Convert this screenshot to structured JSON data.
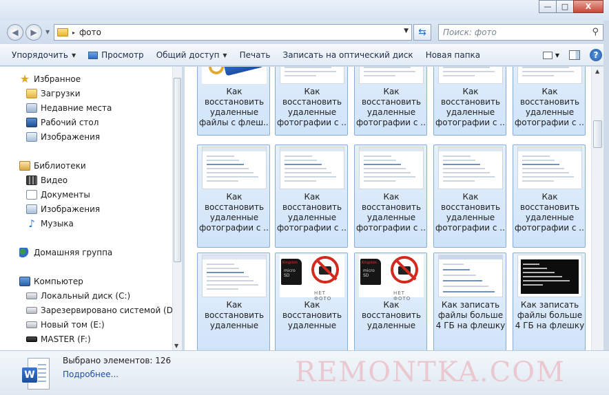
{
  "window": {
    "controls": {
      "minimize": "—",
      "maximize": "□",
      "close": "X"
    }
  },
  "address_bar": {
    "crumb_separator": "▸",
    "folder": "фото",
    "search_placeholder": "Поиск: фото"
  },
  "toolbar": {
    "items": [
      {
        "label": "Упорядочить",
        "has_arrow": true
      },
      {
        "label": "Просмотр",
        "has_arrow": false
      },
      {
        "label": "Общий доступ",
        "has_arrow": true
      },
      {
        "label": "Печать",
        "has_arrow": false
      },
      {
        "label": "Записать на оптический диск",
        "has_arrow": false
      },
      {
        "label": "Новая папка",
        "has_arrow": false
      }
    ],
    "help": "?"
  },
  "nav_pane": {
    "favorites": {
      "label": "Избранное",
      "icon": "star-icon"
    },
    "favorite_items": [
      {
        "label": "Загрузки",
        "icon": "downloads-folder-icon"
      },
      {
        "label": "Недавние места",
        "icon": "recent-places-icon"
      },
      {
        "label": "Рабочий стол",
        "icon": "desktop-icon"
      },
      {
        "label": "Изображения",
        "icon": "pictures-icon"
      }
    ],
    "libraries": {
      "label": "Библиотеки",
      "icon": "library-icon"
    },
    "library_items": [
      {
        "label": "Видео",
        "icon": "video-icon"
      },
      {
        "label": "Документы",
        "icon": "documents-icon"
      },
      {
        "label": "Изображения",
        "icon": "pictures-icon"
      },
      {
        "label": "Музыка",
        "icon": "music-icon"
      }
    ],
    "homegroup": {
      "label": "Домашняя группа",
      "icon": "homegroup-icon"
    },
    "computer": {
      "label": "Компьютер",
      "icon": "computer-icon"
    },
    "drives": [
      {
        "label": "Локальный диск (C:)",
        "icon": "system-drive-icon"
      },
      {
        "label": "Зарезервировано системой (D:)",
        "icon": "drive-icon"
      },
      {
        "label": "Новый том (E:)",
        "icon": "drive-icon"
      },
      {
        "label": "MASTER (F:)",
        "icon": "usb-drive-icon"
      }
    ]
  },
  "files": [
    {
      "line1": "Как",
      "line2": "восстановить",
      "line3": "удаленные",
      "line4": "файлы с флеш...",
      "thumb": "usb-flash"
    },
    {
      "line1": "Как",
      "line2": "восстановить",
      "line3": "удаленные",
      "line4": "фотографии с ...",
      "thumb": "screenshot"
    },
    {
      "line1": "Как",
      "line2": "восстановить",
      "line3": "удаленные",
      "line4": "фотографии с ...",
      "thumb": "screenshot"
    },
    {
      "line1": "Как",
      "line2": "восстановить",
      "line3": "удаленные",
      "line4": "фотографии с ...",
      "thumb": "screenshot"
    },
    {
      "line1": "Как",
      "line2": "восстановить",
      "line3": "удаленные",
      "line4": "фотографии с ...",
      "thumb": "screenshot"
    },
    {
      "line1": "Как",
      "line2": "восстановить",
      "line3": "удаленные",
      "line4": "фотографии с ...",
      "thumb": "screenshot"
    },
    {
      "line1": "Как",
      "line2": "восстановить",
      "line3": "удаленные",
      "line4": "фотографии с ...",
      "thumb": "screenshot"
    },
    {
      "line1": "Как",
      "line2": "восстановить",
      "line3": "удаленные",
      "line4": "фотографии с ...",
      "thumb": "screenshot"
    },
    {
      "line1": "Как",
      "line2": "восстановить",
      "line3": "удаленные",
      "line4": "фотографии с ...",
      "thumb": "screenshot"
    },
    {
      "line1": "Как",
      "line2": "восстановить",
      "line3": "удаленные",
      "line4": "фотографии с ...",
      "thumb": "screenshot"
    },
    {
      "line1": "Как",
      "line2": "восстановить",
      "line3": "удаленные",
      "line4": "",
      "thumb": "screenshot"
    },
    {
      "line1": "Как",
      "line2": "восстановить",
      "line3": "удаленные",
      "line4": "",
      "thumb": "sd-no-photo"
    },
    {
      "line1": "Как",
      "line2": "восстановить",
      "line3": "удаленные",
      "line4": "",
      "thumb": "sd-no-photo"
    },
    {
      "line1": "Как записать",
      "line2": "файлы больше",
      "line3": "4 ГБ на флешку",
      "line4": "",
      "thumb": "dialog"
    },
    {
      "line1": "Как записать",
      "line2": "файлы больше",
      "line3": "4 ГБ на флешку",
      "line4": "",
      "thumb": "console"
    }
  ],
  "thumb_text": {
    "sd_brand": "Kingston",
    "sd_type": "micro SD",
    "no_photo": "НЕТ ФОТО"
  },
  "details": {
    "selected": "Выбрано элементов: 126",
    "more": "Подробнее...",
    "file_icon": "word-document-icon",
    "watermark": "REMONTKA.COM"
  },
  "colors": {
    "selection_fill": "#cfe3f9",
    "selection_border": "#84acdd",
    "link": "#1f4ea8"
  }
}
